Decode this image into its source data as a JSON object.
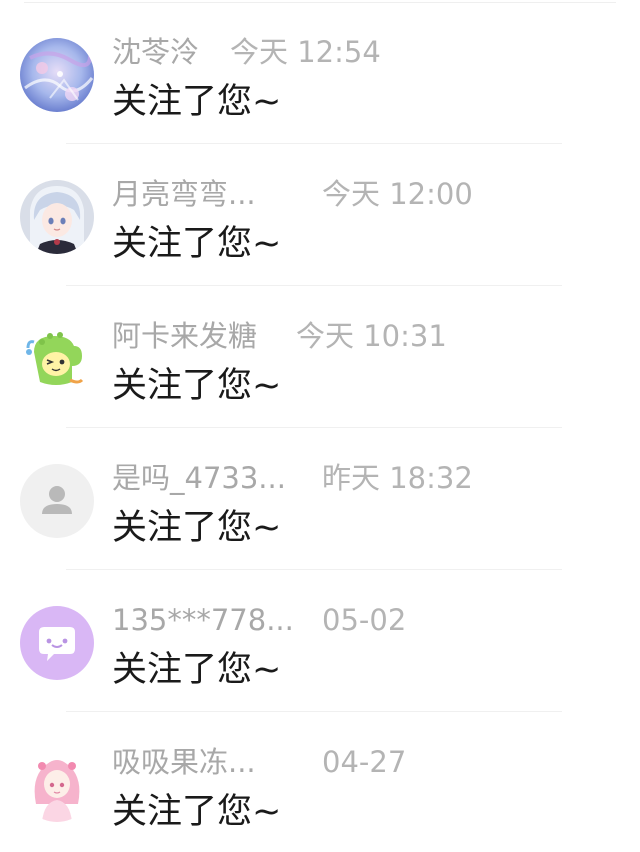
{
  "notifications": [
    {
      "name": "沈苓泠",
      "time": "今天 12:54",
      "message": "关注了您~",
      "avatar": "anime-blue-floral-avatar"
    },
    {
      "name": "月亮弯弯...",
      "time": "今天 12:00",
      "message": "关注了您~",
      "avatar": "anime-silver-hair-girl-avatar"
    },
    {
      "name": "阿卡来发糖",
      "time": "今天 10:31",
      "message": "关注了您~",
      "avatar": "green-dinosaur-cartoon-avatar"
    },
    {
      "name": "是吗_4733...",
      "time": "昨天 18:32",
      "message": "关注了您~",
      "avatar": "default-user-avatar"
    },
    {
      "name": "135***778...",
      "time": "05-02",
      "message": "关注了您~",
      "avatar": "purple-chat-bubble-avatar"
    },
    {
      "name": "吸吸果冻...",
      "time": "04-27",
      "message": "关注了您~",
      "avatar": "pink-anime-girl-avatar"
    }
  ],
  "colors": {
    "name_text": "#a8a8a8",
    "time_text": "#b4b4b4",
    "message_text": "#1a1a1a",
    "default_avatar_bg": "#f0f0f0",
    "chat_avatar_bg": "#d9b7f5"
  }
}
